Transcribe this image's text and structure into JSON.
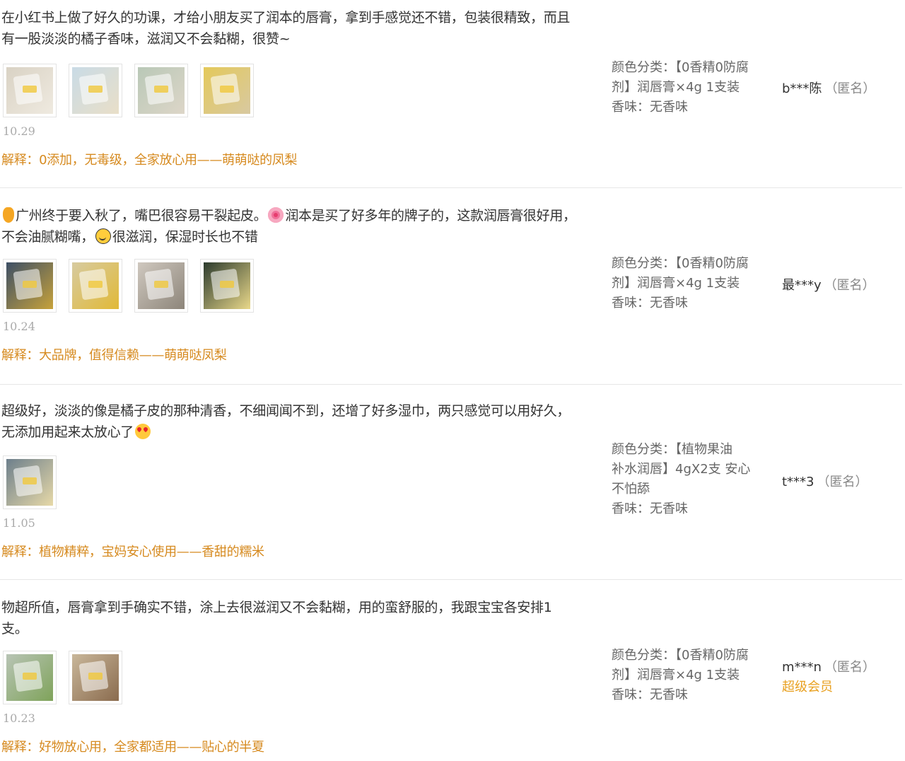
{
  "reviews": [
    {
      "text_parts": [
        "在小红书上做了好久的功课，才给小朋友买了润本的唇膏，拿到手感觉还不错，包装很精致，而且有一股淡淡的橘子香味，滋润又不会黏糊，很赞~"
      ],
      "photos": [
        {
          "icon": "photo-lipbalm-unboxed",
          "colors": [
            "#d9d2c4",
            "#efeae0"
          ]
        },
        {
          "icon": "photo-lipbalm-box-hand",
          "colors": [
            "#c9dbe6",
            "#e9dfc8"
          ]
        },
        {
          "icon": "photo-lipbalm-box-hand-2",
          "colors": [
            "#b9c8b7",
            "#ddd6c8"
          ]
        },
        {
          "icon": "photo-lipbalm-box-yellow",
          "colors": [
            "#e4c95a",
            "#d8c9a1"
          ]
        }
      ],
      "date": "10.29",
      "reply": "解释：0添加，无毒级，全家放心用——萌萌哒的凤梨",
      "sku_lines": [
        "颜色分类：【0香精0防腐",
        "剂】润唇膏×4g 1支装",
        "香味：无香味"
      ],
      "user": {
        "nick": "b***陈",
        "anon": "（匿名）",
        "vip": ""
      }
    },
    {
      "text_parts": [
        "广州终于要入秋了，嘴巴很容易干裂起皮。",
        "润本是买了好多年的牌子的，这款润唇膏很好用，不会油腻糊嘴，",
        "很滋润，保湿时长也不错"
      ],
      "photos": [
        {
          "icon": "photo-lipbalm-desk",
          "colors": [
            "#3d4f66",
            "#c7a23b"
          ]
        },
        {
          "icon": "photo-lipbalm-package",
          "colors": [
            "#d7cba0",
            "#e1b937"
          ]
        },
        {
          "icon": "photo-lipbalm-hand",
          "colors": [
            "#cfc8bf",
            "#8d857a"
          ]
        },
        {
          "icon": "photo-lipbalm-box-dark",
          "colors": [
            "#2c3b2e",
            "#e9d88a"
          ]
        }
      ],
      "date": "10.24",
      "reply": "解释：大品牌，值得信赖——萌萌哒凤梨",
      "sku_lines": [
        "颜色分类：【0香精0防腐",
        "剂】润唇膏×4g 1支装",
        "香味：无香味"
      ],
      "user": {
        "nick": "最***y",
        "anon": "（匿名）",
        "vip": ""
      }
    },
    {
      "text_parts": [
        "超级好，淡淡的像是橘子皮的那种清香，不细闻闻不到，还增了好多湿巾，两只感觉可以用好久，无添加用起来太放心了"
      ],
      "photos": [
        {
          "icon": "photo-lipbalm-table",
          "colors": [
            "#6d7f8c",
            "#e7d9a8"
          ]
        }
      ],
      "date": "11.05",
      "reply": "解释：植物精粹，宝妈安心使用——香甜的糯米",
      "sku_lines": [
        "颜色分类：【植物果油",
        "补水润唇】4gX2支 安心",
        "不怕舔",
        "香味：无香味"
      ],
      "user": {
        "nick": "t***3",
        "anon": "（匿名）",
        "vip": ""
      }
    },
    {
      "text_parts": [
        "物超所值，唇膏拿到手确实不错，涂上去很滋润又不会黏糊，用的蛮舒服的，我跟宝宝各安排1支。"
      ],
      "photos": [
        {
          "icon": "photo-lipbalm-in-hand",
          "colors": [
            "#b8c4b5",
            "#7fa35a"
          ]
        },
        {
          "icon": "photo-child-using-lipbalm",
          "colors": [
            "#c9b79a",
            "#8a6b4e"
          ]
        }
      ],
      "date": "10.23",
      "reply": "解释：好物放心用，全家都适用——贴心的半夏",
      "sku_lines": [
        "颜色分类：【0香精0防腐",
        "剂】润唇膏×4g 1支装",
        "香味：无香味"
      ],
      "user": {
        "nick": "m***n",
        "anon": "（匿名）",
        "vip": "超级会员"
      }
    }
  ]
}
